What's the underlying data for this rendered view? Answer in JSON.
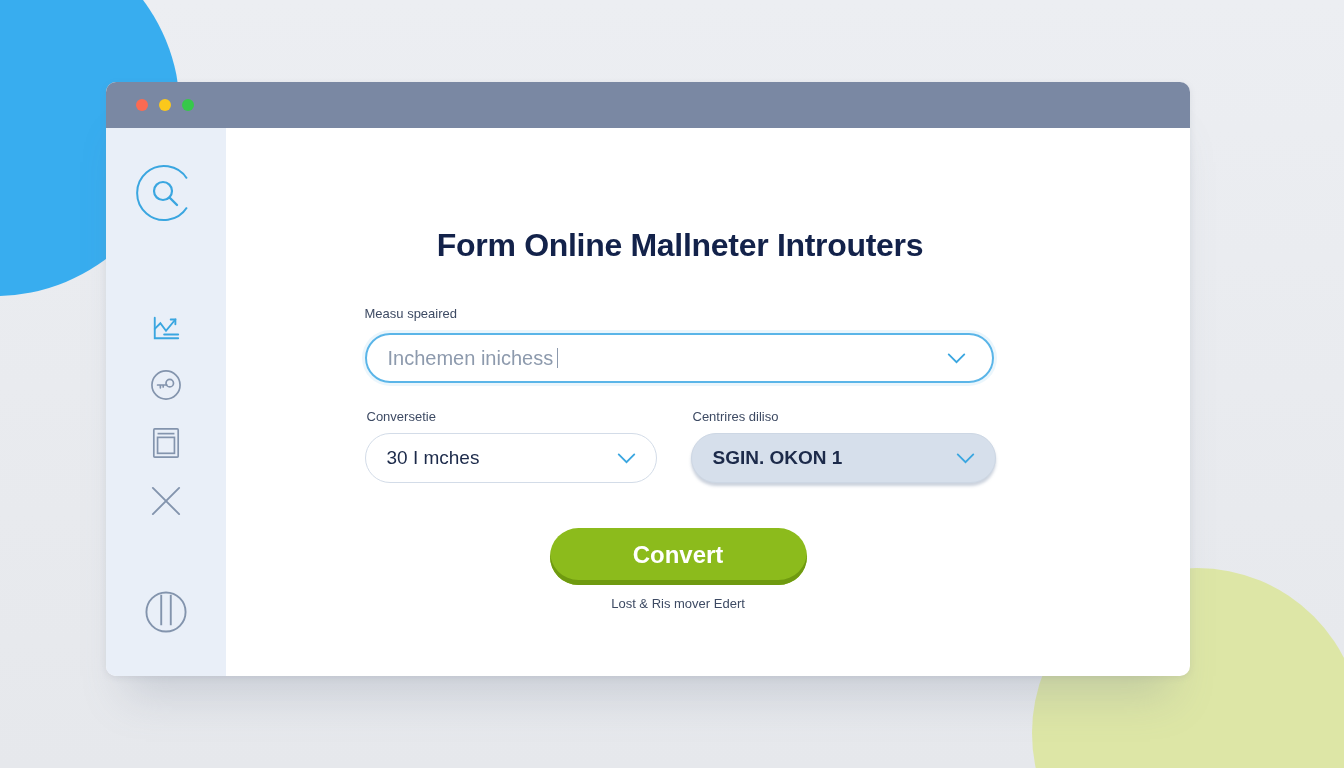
{
  "sidebar": {
    "items": [
      {
        "kind": "chart",
        "selected": true
      },
      {
        "kind": "key",
        "selected": false
      },
      {
        "kind": "window",
        "selected": false
      },
      {
        "kind": "close",
        "selected": false
      }
    ]
  },
  "form": {
    "title": "Form Online Mallneter Introuters",
    "measure_field": {
      "label": "Measu speaired",
      "value": "Inchemen inichess",
      "focused": true
    },
    "conversion_fields": [
      {
        "label": "Conversetie",
        "value": "30 I mches",
        "kind": "outlined"
      },
      {
        "label": "Centrires diliso",
        "value": "SGIN. OKON 1",
        "kind": "filled"
      }
    ],
    "convert_button": {
      "label": "Convert"
    },
    "footer_note": "Lost & Ris mover Edert"
  }
}
